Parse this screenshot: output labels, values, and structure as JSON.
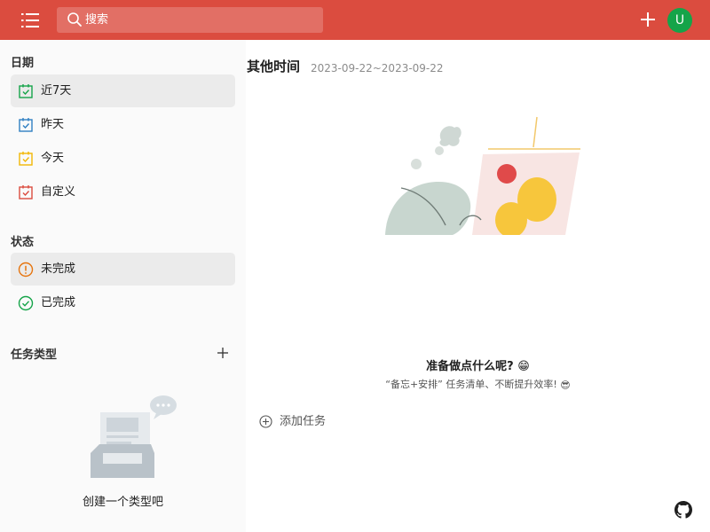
{
  "topbar": {
    "search_placeholder": "搜索",
    "avatar_letter": "U",
    "bg_color": "#db4c3f",
    "avatar_color": "#15a449"
  },
  "sidebar": {
    "date_section": {
      "title": "日期",
      "items": [
        {
          "label": "近7天",
          "icon": "calendar-check-icon",
          "color": "#15a449",
          "active": true
        },
        {
          "label": "昨天",
          "icon": "calendar-check-icon",
          "color": "#2f80c2",
          "active": false
        },
        {
          "label": "今天",
          "icon": "calendar-check-icon",
          "color": "#f2b705",
          "active": false
        },
        {
          "label": "自定义",
          "icon": "calendar-check-icon",
          "color": "#db4c3f",
          "active": false
        }
      ]
    },
    "status_section": {
      "title": "状态",
      "items": [
        {
          "label": "未完成",
          "icon": "exclamation-circle-icon",
          "color": "#e6740d",
          "active": true
        },
        {
          "label": "已完成",
          "icon": "check-circle-icon",
          "color": "#15a449",
          "active": false
        }
      ]
    },
    "type_section": {
      "title": "任务类型",
      "empty_text": "创建一个类型吧"
    }
  },
  "main": {
    "title": "其他时间",
    "date_range": "2023-09-22~2023-09-22",
    "prompt_title": "准备做点什么呢?",
    "prompt_title_emoji": "😁",
    "prompt_subtitle": "“备忘+安排” 任务清单、不断提升效率!",
    "prompt_subtitle_emoji": "😎",
    "add_task_label": "添加任务"
  }
}
